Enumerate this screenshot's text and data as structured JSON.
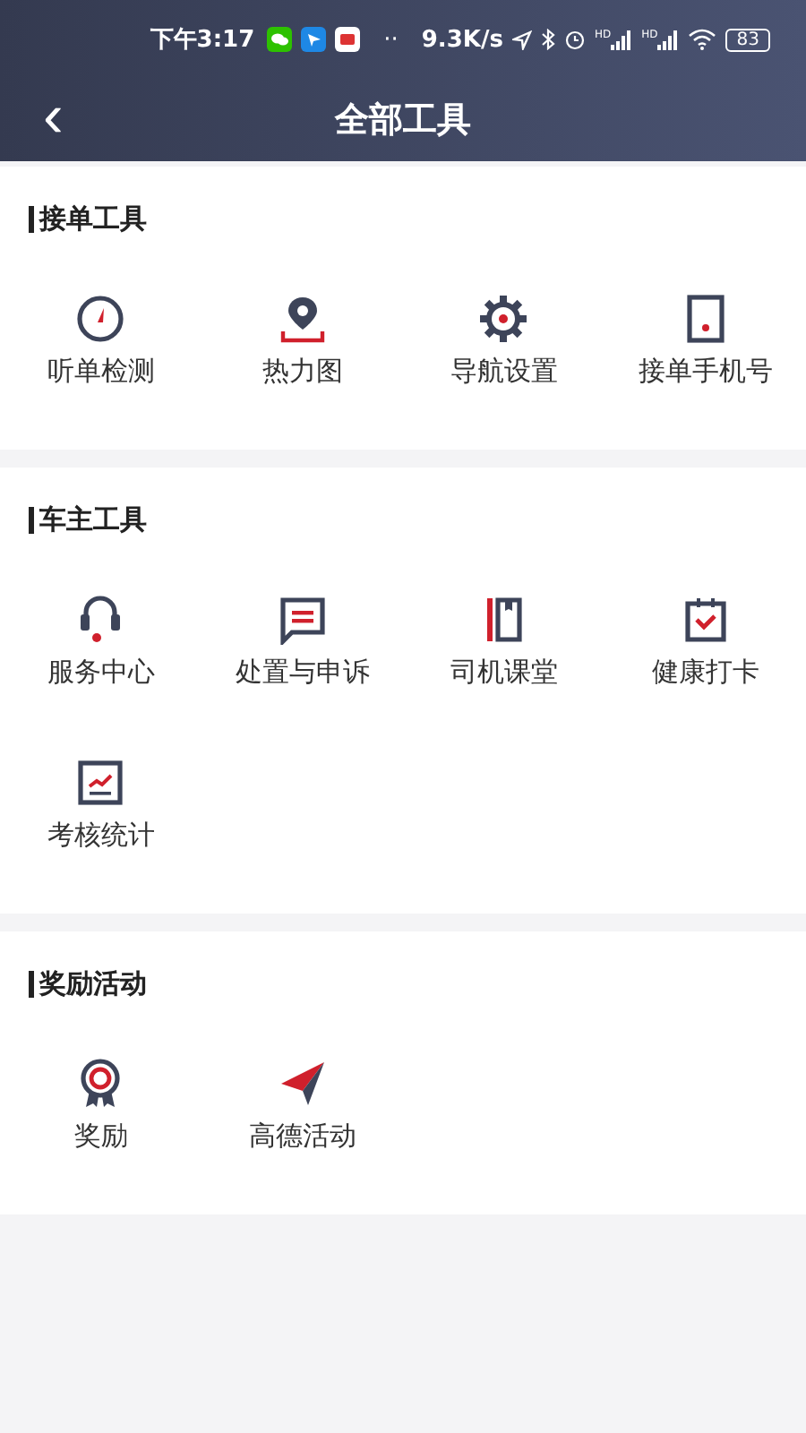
{
  "status_bar": {
    "time": "下午3:17",
    "more": "··",
    "speed": "9.3K/s",
    "signal_labels": [
      "HD",
      "HD"
    ],
    "battery": "83"
  },
  "nav": {
    "back": "‹",
    "title": "全部工具"
  },
  "sections": [
    {
      "title": "接单工具",
      "tools": [
        {
          "kind": "gauge",
          "label": "听单检测"
        },
        {
          "kind": "pin",
          "label": "热力图"
        },
        {
          "kind": "gear",
          "label": "导航设置"
        },
        {
          "kind": "phone",
          "label": "接单手机号"
        }
      ]
    },
    {
      "title": "车主工具",
      "tools": [
        {
          "kind": "headset",
          "label": "服务中心"
        },
        {
          "kind": "message",
          "label": "处置与申诉"
        },
        {
          "kind": "book",
          "label": "司机课堂"
        },
        {
          "kind": "calendar",
          "label": "健康打卡"
        },
        {
          "kind": "chart",
          "label": "考核统计"
        }
      ]
    },
    {
      "title": "奖励活动",
      "tools": [
        {
          "kind": "medal",
          "label": "奖励"
        },
        {
          "kind": "plane",
          "label": "高德活动"
        }
      ]
    }
  ]
}
